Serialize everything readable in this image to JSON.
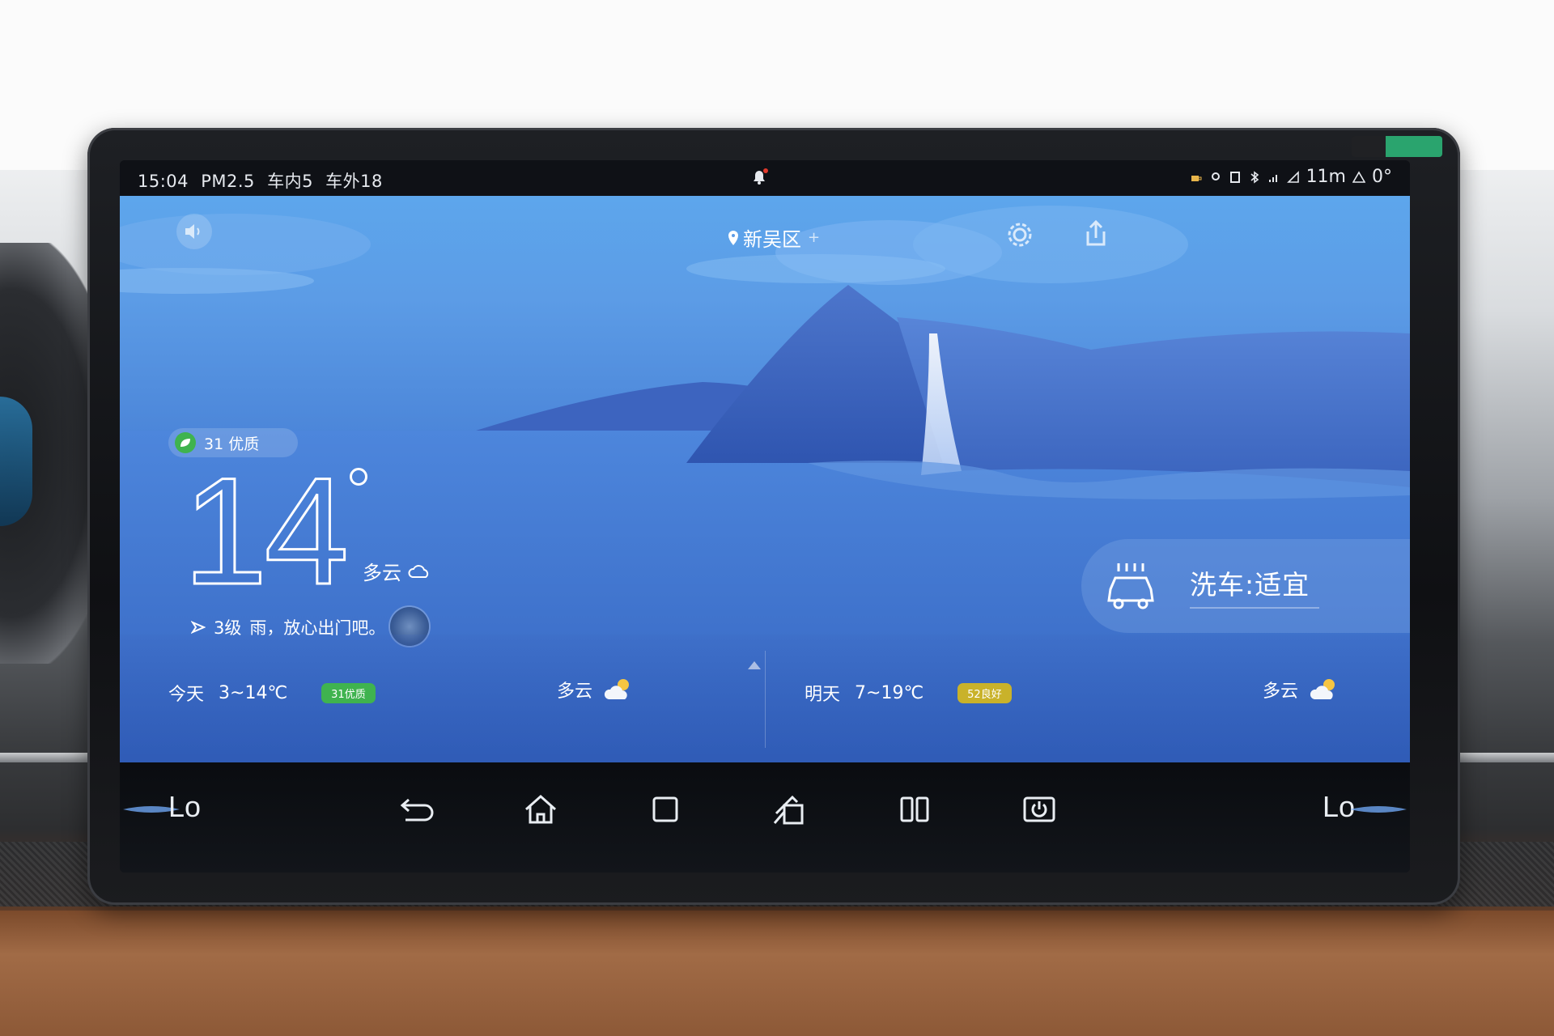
{
  "statusbar": {
    "time": "15:04",
    "pm25": "PM2.5",
    "inside": "车内5",
    "outside": "车外18",
    "storage": "11m",
    "signal_value": "0°"
  },
  "weather": {
    "location": "新吴区",
    "location_add": "+",
    "aqi": "31 优质",
    "temperature": "14",
    "condition": "多云",
    "wind": "3级",
    "tip": "雨，放心出门吧。",
    "wash": "洗车:适宜"
  },
  "forecast": {
    "today": {
      "label": "今天",
      "range": "3~14℃",
      "aqi": "31优质",
      "aqi_color": "#3fb34f",
      "condition": "多云"
    },
    "tomorrow": {
      "label": "明天",
      "range": "7~19℃",
      "aqi": "52良好",
      "aqi_color": "#c9b22a",
      "condition": "多云"
    }
  },
  "navbar": {
    "left_mode": "Lo",
    "right_mode": "Lo",
    "icons": [
      "back-icon",
      "home-icon",
      "recent-apps-icon",
      "screen-share-icon",
      "split-screen-icon",
      "power-icon"
    ]
  },
  "colors": {
    "sky_top": "#5da6ec",
    "sky_bottom": "#3564bf",
    "accent_green": "#3fb34f"
  }
}
